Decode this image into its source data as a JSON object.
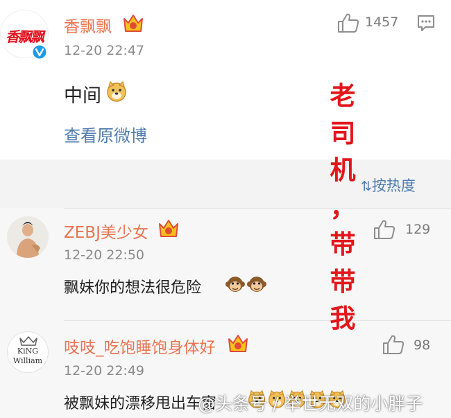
{
  "post": {
    "avatar_text": "香飘飘",
    "user": "香飘飘",
    "time": "12-20 22:47",
    "likes": "1457",
    "text": "中间",
    "emoji": "doge-icon",
    "view_original": "查看原微博"
  },
  "sort_label": "按热度",
  "overlay_chars": [
    "老",
    "司",
    "机",
    "，",
    "带",
    "带",
    "我"
  ],
  "comments": [
    {
      "user": "ZEBJ美少女",
      "time": "12-20 22:50",
      "text": "飘妹你的想法很危险",
      "emojis": [
        "monkey-icon",
        "monkey-icon"
      ],
      "likes": "129"
    },
    {
      "user": "吱吱_吃饱睡饱身体好",
      "avatar_text": [
        "KiNG",
        "William"
      ],
      "time": "12-20 22:49",
      "text": "被飘妹的漂移甩出车窗",
      "emojis": [
        "doge-icon",
        "doge-icon",
        "doge-icon",
        "doge-icon",
        "doge-icon"
      ],
      "likes": "98"
    }
  ],
  "watermark": "@头条号 / 举世无双的小胖子",
  "colors": {
    "username": "#eb7350",
    "link": "#507daf",
    "overlay": "#e3161c",
    "badge": "#1e9be8"
  }
}
